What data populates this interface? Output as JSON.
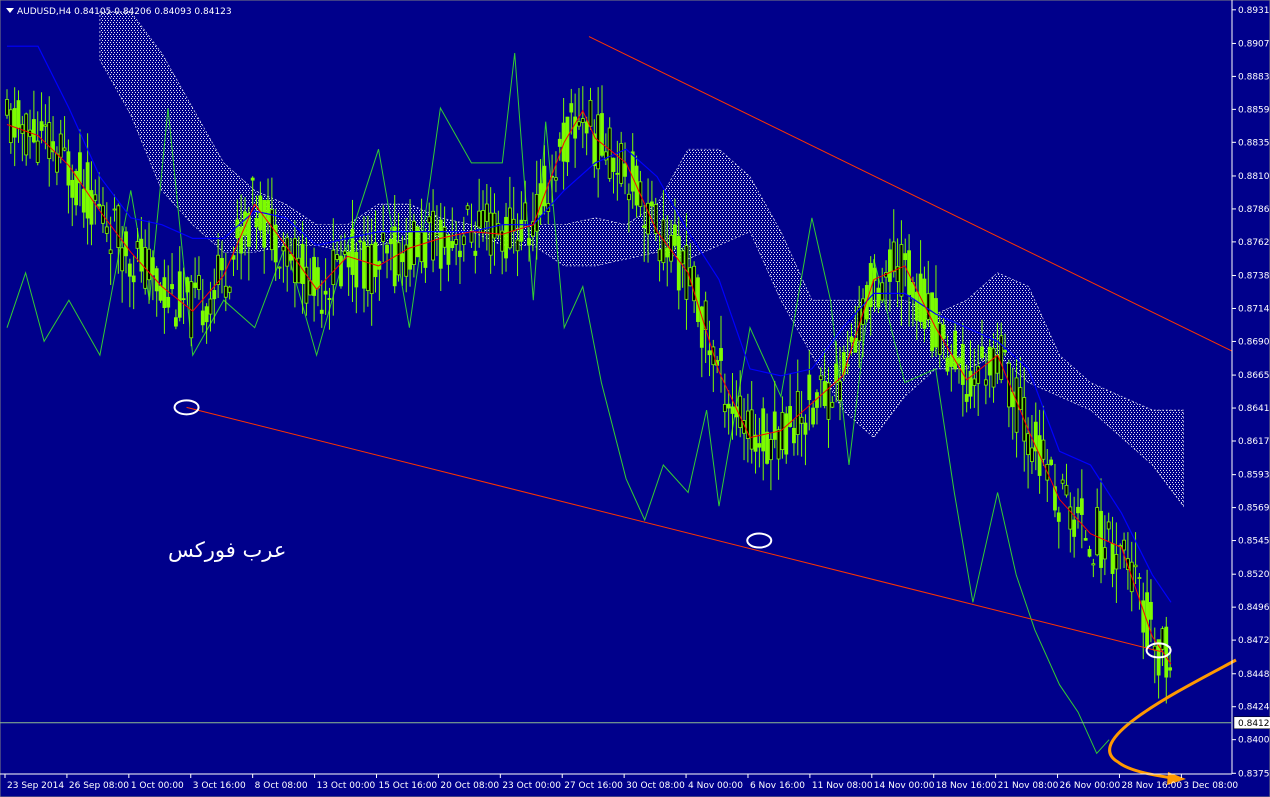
{
  "window": {
    "symbol": "AUDUSD,H4",
    "ohlc": [
      "0.84105",
      "0.84206",
      "0.84093",
      "0.84123"
    ]
  },
  "watermark": "عرب فوركس",
  "colors": {
    "background": "#00008b",
    "candles": "#7cfc00",
    "tenkan": "#ff0000",
    "kijun": "#0000ff",
    "chikou": "#32cd32",
    "cloud": "#ffffff",
    "trendline": "#ff3300",
    "arrow": "#ff9900",
    "circle": "#ffffff",
    "price_line": "#8fbc8f"
  },
  "chart_data": {
    "type": "line",
    "yaxis": {
      "min": 0.8375,
      "max": 0.8935,
      "ticks": [
        "0.89315",
        "0.89070",
        "0.88830",
        "0.88590",
        "0.88350",
        "0.88105",
        "0.87865",
        "0.87625",
        "0.87380",
        "0.87140",
        "0.86900",
        "0.86655",
        "0.86415",
        "0.86175",
        "0.85930",
        "0.85690",
        "0.85450",
        "0.85205",
        "0.84965",
        "0.84725",
        "0.84480",
        "0.84240",
        "0.84000",
        "0.83755"
      ],
      "current_price": "0.84123"
    },
    "xaxis": {
      "ticks": [
        "23 Sep 2014",
        "26 Sep 08:00",
        "1 Oct 00:00",
        "3 Oct 16:00",
        "8 Oct 08:00",
        "13 Oct 00:00",
        "15 Oct 16:00",
        "20 Oct 08:00",
        "23 Oct 00:00",
        "27 Oct 16:00",
        "30 Oct 08:00",
        "4 Nov 00:00",
        "6 Nov 16:00",
        "11 Nov 08:00",
        "14 Nov 00:00",
        "18 Nov 16:00",
        "21 Nov 08:00",
        "26 Nov 00:00",
        "28 Nov 16:00",
        "3 Dec 08:00"
      ]
    },
    "series": [
      {
        "type": "line",
        "points": [
          [
            0,
            0.8848
          ],
          [
            0.5,
            0.884
          ],
          [
            1,
            0.8818
          ],
          [
            1.5,
            0.8785
          ],
          [
            2,
            0.8755
          ],
          [
            2.5,
            0.873
          ],
          [
            3,
            0.8712
          ],
          [
            3.5,
            0.8738
          ],
          [
            4,
            0.879
          ],
          [
            4.5,
            0.876
          ],
          [
            5,
            0.8728
          ],
          [
            5.5,
            0.8752
          ],
          [
            6,
            0.8745
          ],
          [
            6.5,
            0.8758
          ],
          [
            7,
            0.8765
          ],
          [
            7.5,
            0.877
          ],
          [
            8,
            0.8768
          ],
          [
            8.5,
            0.8775
          ],
          [
            9,
            0.8835
          ],
          [
            9.3,
            0.8858
          ],
          [
            9.5,
            0.8838
          ],
          [
            10,
            0.882
          ],
          [
            10.5,
            0.877
          ],
          [
            11,
            0.874
          ],
          [
            11.5,
            0.8668
          ],
          [
            12,
            0.862
          ],
          [
            12.5,
            0.8625
          ],
          [
            13,
            0.8645
          ],
          [
            13.5,
            0.8665
          ],
          [
            14,
            0.8735
          ],
          [
            14.5,
            0.8745
          ],
          [
            15,
            0.87
          ],
          [
            15.5,
            0.8662
          ],
          [
            16,
            0.868
          ],
          [
            16.5,
            0.8625
          ],
          [
            17,
            0.8575
          ],
          [
            17.5,
            0.855
          ],
          [
            18,
            0.854
          ],
          [
            18.5,
            0.8475
          ],
          [
            18.8,
            0.8455
          ]
        ]
      },
      {
        "type": "line",
        "points": [
          [
            0,
            0.8905
          ],
          [
            0.5,
            0.8905
          ],
          [
            1,
            0.886
          ],
          [
            1.5,
            0.881
          ],
          [
            2,
            0.878
          ],
          [
            2.5,
            0.8775
          ],
          [
            3,
            0.8765
          ],
          [
            3.5,
            0.8765
          ],
          [
            4,
            0.8785
          ],
          [
            4.5,
            0.878
          ],
          [
            5,
            0.876
          ],
          [
            5.5,
            0.8765
          ],
          [
            6,
            0.877
          ],
          [
            6.5,
            0.877
          ],
          [
            7,
            0.877
          ],
          [
            7.5,
            0.877
          ],
          [
            8,
            0.8775
          ],
          [
            8.5,
            0.8775
          ],
          [
            9,
            0.88
          ],
          [
            9.5,
            0.882
          ],
          [
            10,
            0.883
          ],
          [
            10.5,
            0.881
          ],
          [
            11,
            0.877
          ],
          [
            11.5,
            0.8735
          ],
          [
            12,
            0.867
          ],
          [
            12.5,
            0.8665
          ],
          [
            13,
            0.867
          ],
          [
            13.5,
            0.87
          ],
          [
            14,
            0.8725
          ],
          [
            14.5,
            0.8725
          ],
          [
            15,
            0.871
          ],
          [
            15.5,
            0.87
          ],
          [
            16,
            0.869
          ],
          [
            16.5,
            0.867
          ],
          [
            17,
            0.861
          ],
          [
            17.5,
            0.86
          ],
          [
            18,
            0.8565
          ],
          [
            18.5,
            0.852
          ],
          [
            18.8,
            0.85
          ]
        ]
      },
      {
        "type": "line",
        "points": [
          [
            0,
            0.87
          ],
          [
            0.3,
            0.874
          ],
          [
            0.6,
            0.869
          ],
          [
            1,
            0.872
          ],
          [
            1.5,
            0.868
          ],
          [
            2,
            0.88
          ],
          [
            2.3,
            0.872
          ],
          [
            2.6,
            0.886
          ],
          [
            3,
            0.868
          ],
          [
            3.5,
            0.872
          ],
          [
            4,
            0.87
          ],
          [
            4.5,
            0.876
          ],
          [
            5,
            0.868
          ],
          [
            5.5,
            0.876
          ],
          [
            6,
            0.883
          ],
          [
            6.5,
            0.87
          ],
          [
            7,
            0.886
          ],
          [
            7.5,
            0.882
          ],
          [
            8,
            0.882
          ],
          [
            8.2,
            0.89
          ],
          [
            8.5,
            0.872
          ],
          [
            8.7,
            0.885
          ],
          [
            9,
            0.87
          ],
          [
            9.3,
            0.873
          ],
          [
            9.6,
            0.866
          ],
          [
            10,
            0.859
          ],
          [
            10.3,
            0.856
          ],
          [
            10.6,
            0.86
          ],
          [
            11,
            0.858
          ],
          [
            11.3,
            0.864
          ],
          [
            11.5,
            0.857
          ],
          [
            12,
            0.87
          ],
          [
            12.5,
            0.865
          ],
          [
            13,
            0.878
          ],
          [
            13.3,
            0.872
          ],
          [
            13.6,
            0.86
          ],
          [
            14,
            0.875
          ],
          [
            14.5,
            0.866
          ],
          [
            15,
            0.867
          ],
          [
            15.3,
            0.858
          ],
          [
            15.6,
            0.85
          ],
          [
            16,
            0.858
          ],
          [
            16.3,
            0.852
          ],
          [
            16.6,
            0.848
          ],
          [
            17,
            0.844
          ],
          [
            17.3,
            0.842
          ],
          [
            17.6,
            0.839
          ],
          [
            17.8,
            0.84
          ]
        ]
      },
      {
        "type": "area",
        "points": [
          [
            1.5,
            0.893,
            0.8895
          ],
          [
            2,
            0.893,
            0.8855
          ],
          [
            2.5,
            0.89,
            0.88
          ],
          [
            3,
            0.886,
            0.8775
          ],
          [
            3.5,
            0.882,
            0.8755
          ],
          [
            4,
            0.88,
            0.8755
          ],
          [
            4.5,
            0.879,
            0.876
          ],
          [
            5,
            0.8775,
            0.876
          ],
          [
            5.5,
            0.8775,
            0.8755
          ],
          [
            6,
            0.879,
            0.876
          ],
          [
            6.5,
            0.879,
            0.8765
          ],
          [
            7,
            0.878,
            0.8765
          ],
          [
            7.5,
            0.8775,
            0.877
          ],
          [
            8,
            0.877,
            0.876
          ],
          [
            8.5,
            0.8775,
            0.876
          ],
          [
            9,
            0.8775,
            0.8745
          ],
          [
            9.5,
            0.878,
            0.8745
          ],
          [
            10,
            0.8775,
            0.875
          ],
          [
            10.5,
            0.879,
            0.8755
          ],
          [
            11,
            0.883,
            0.875
          ],
          [
            11.5,
            0.883,
            0.876
          ],
          [
            12,
            0.881,
            0.877
          ],
          [
            12.5,
            0.877,
            0.872
          ],
          [
            13,
            0.872,
            0.868
          ],
          [
            13.5,
            0.872,
            0.864
          ],
          [
            14,
            0.872,
            0.862
          ],
          [
            14.5,
            0.872,
            0.865
          ],
          [
            15,
            0.871,
            0.867
          ],
          [
            15.5,
            0.872,
            0.867
          ],
          [
            16,
            0.874,
            0.868
          ],
          [
            16.5,
            0.873,
            0.866
          ],
          [
            17,
            0.868,
            0.865
          ],
          [
            17.5,
            0.866,
            0.864
          ],
          [
            18,
            0.865,
            0.862
          ],
          [
            18.5,
            0.864,
            0.86
          ],
          [
            19,
            0.864,
            0.857
          ]
        ]
      }
    ]
  }
}
